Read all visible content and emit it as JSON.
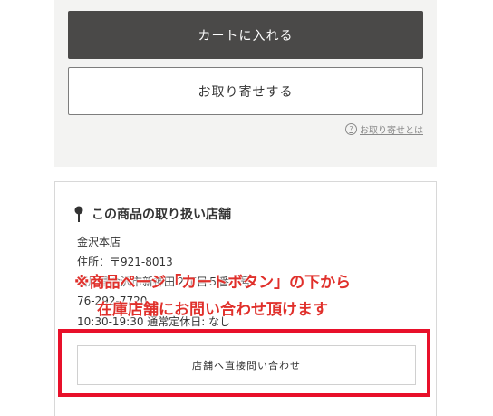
{
  "purchase": {
    "cart_button": "カートに入れる",
    "order_button": "お取り寄せする",
    "help_icon_glyph": "?",
    "help_link": "お取り寄せとは"
  },
  "store": {
    "title": "この商品の取り扱い店舗",
    "name": "金沢本店",
    "postal": "住所：〒921-8013",
    "address": "石川県金沢市新神田２丁目５番１号",
    "phone": "76-292-7720",
    "hours": "10:30-19:30 通常定休日: なし",
    "contact_button": "店舗へ直接問い合わせ"
  },
  "annotation": {
    "line1": "※商品ページ「カートボタン」の下から",
    "line2": "在庫店舗にお問い合わせ頂けます",
    "color": "#e0302b",
    "box_color": "#e8102a"
  }
}
